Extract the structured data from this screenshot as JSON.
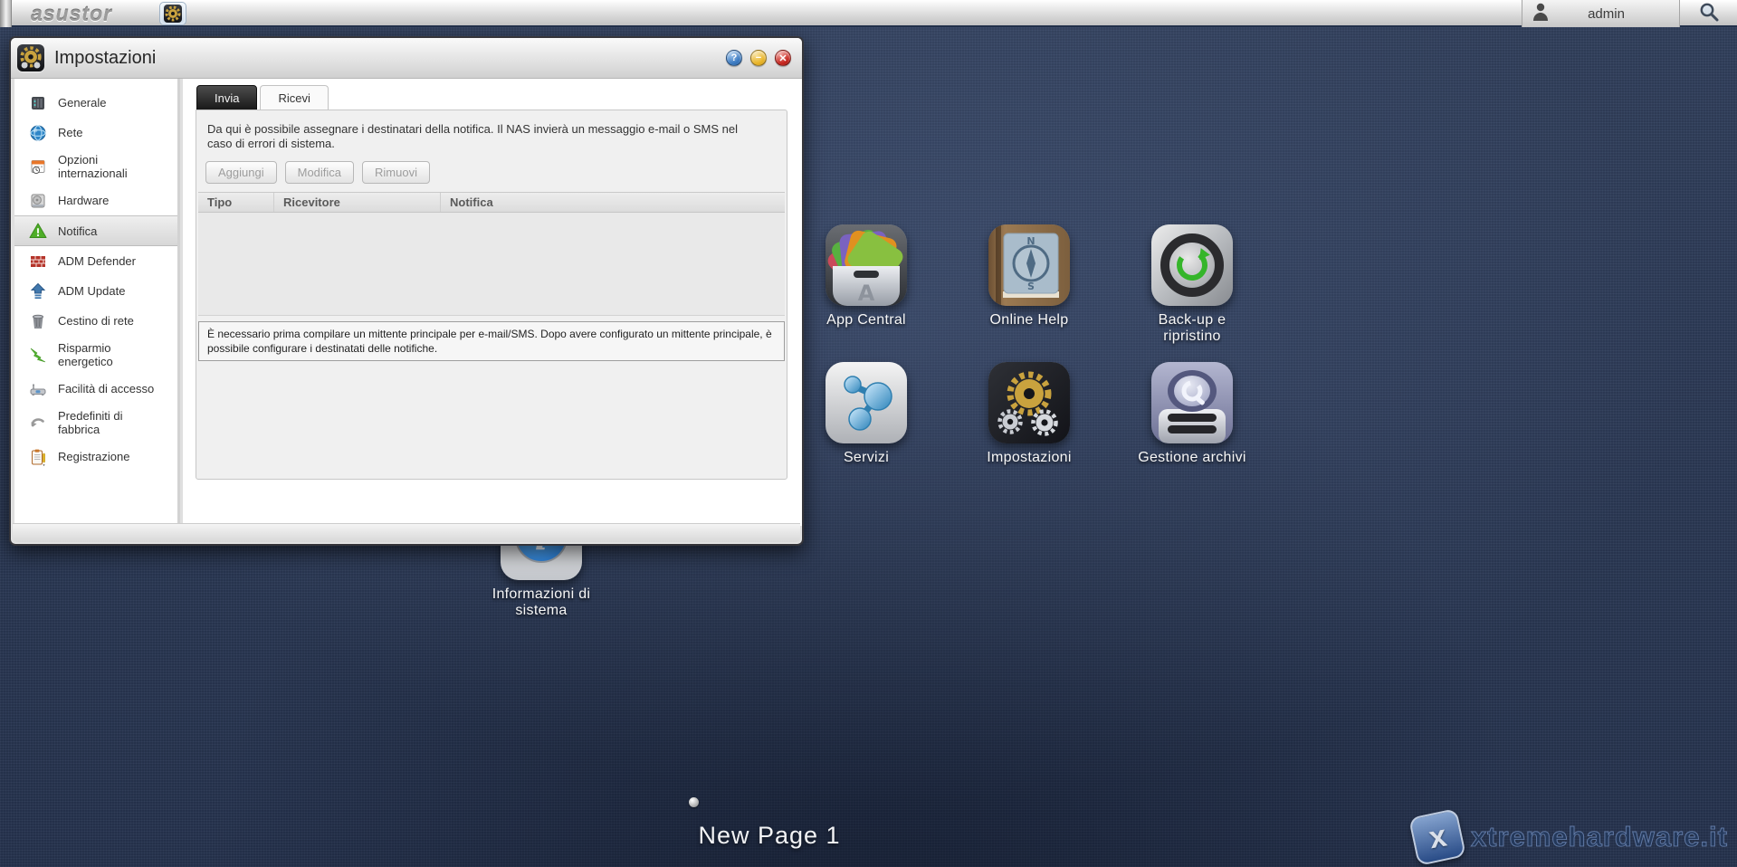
{
  "topbar": {
    "logo": "asustor",
    "taskbar_icon": "gears-icon",
    "user": "admin",
    "search_icon": "search-icon"
  },
  "window": {
    "title": "Impostazioni",
    "controls": {
      "help": "?",
      "minimize": "−",
      "close": "✕"
    },
    "sidebar": {
      "items": [
        {
          "label": "Generale",
          "icon": "server-icon",
          "selected": false
        },
        {
          "label": "Rete",
          "icon": "globe-icon",
          "selected": false
        },
        {
          "label": "Opzioni internazionali",
          "icon": "calendar-clock-icon",
          "selected": false
        },
        {
          "label": "Hardware",
          "icon": "hard-disk-icon",
          "selected": false
        },
        {
          "label": "Notifica",
          "icon": "warning-triangle-icon",
          "selected": true
        },
        {
          "label": "ADM Defender",
          "icon": "firewall-icon",
          "selected": false
        },
        {
          "label": "ADM Update",
          "icon": "up-arrow-icon",
          "selected": false
        },
        {
          "label": "Cestino di rete",
          "icon": "trash-icon",
          "selected": false
        },
        {
          "label": "Risparmio energetico",
          "icon": "lightning-icon",
          "selected": false
        },
        {
          "label": "Facilità di accesso",
          "icon": "router-icon",
          "selected": false
        },
        {
          "label": "Predefiniti di fabbrica",
          "icon": "undo-arrow-icon",
          "selected": false
        },
        {
          "label": "Registrazione",
          "icon": "clipboard-icon",
          "selected": false
        }
      ]
    },
    "tabs": [
      {
        "label": "Invia",
        "active": false
      },
      {
        "label": "Ricevi",
        "active": true
      }
    ],
    "panel": {
      "description": "Da qui è possibile assegnare i destinatari della notifica. Il NAS invierà un messaggio e-mail o SMS nel caso di errori di sistema.",
      "buttons": [
        {
          "label": "Aggiungi",
          "enabled": false
        },
        {
          "label": "Modifica",
          "enabled": false
        },
        {
          "label": "Rimuovi",
          "enabled": false
        }
      ],
      "table": {
        "columns": [
          "Tipo",
          "Ricevitore",
          "Notifica"
        ],
        "rows": []
      },
      "notice": "È necessario prima compilare un mittente principale per e-mail/SMS. Dopo avere configurato un mittente principale, è possibile configurare i destinatati delle notifiche."
    }
  },
  "desktop": {
    "icons": [
      {
        "label": "App Central"
      },
      {
        "label": "Online Help"
      },
      {
        "label": "Back-up e ripristino"
      },
      {
        "label": "Servizi"
      },
      {
        "label": "Impostazioni"
      },
      {
        "label": "Gestione archivi"
      },
      {
        "label": "Informazioni di sistema"
      }
    ],
    "page_label": "New Page 1",
    "watermark": "xtremehardware.it"
  },
  "colors": {
    "desktop_bg": "#2e3e5c",
    "topbar_bg": "#d9d9d9",
    "active_tab_bg": "#fafafa",
    "inactive_tab_bg": "#2b2b2b",
    "selected_sidebar_bg": "#dcdcdc",
    "help_button": "#3a79c0",
    "minimize_button": "#e9b427",
    "close_button": "#c6251e",
    "notifica_icon_green": "#4fae28",
    "backup_green": "#3fae2a",
    "gold_gear": "#c9a23e"
  }
}
